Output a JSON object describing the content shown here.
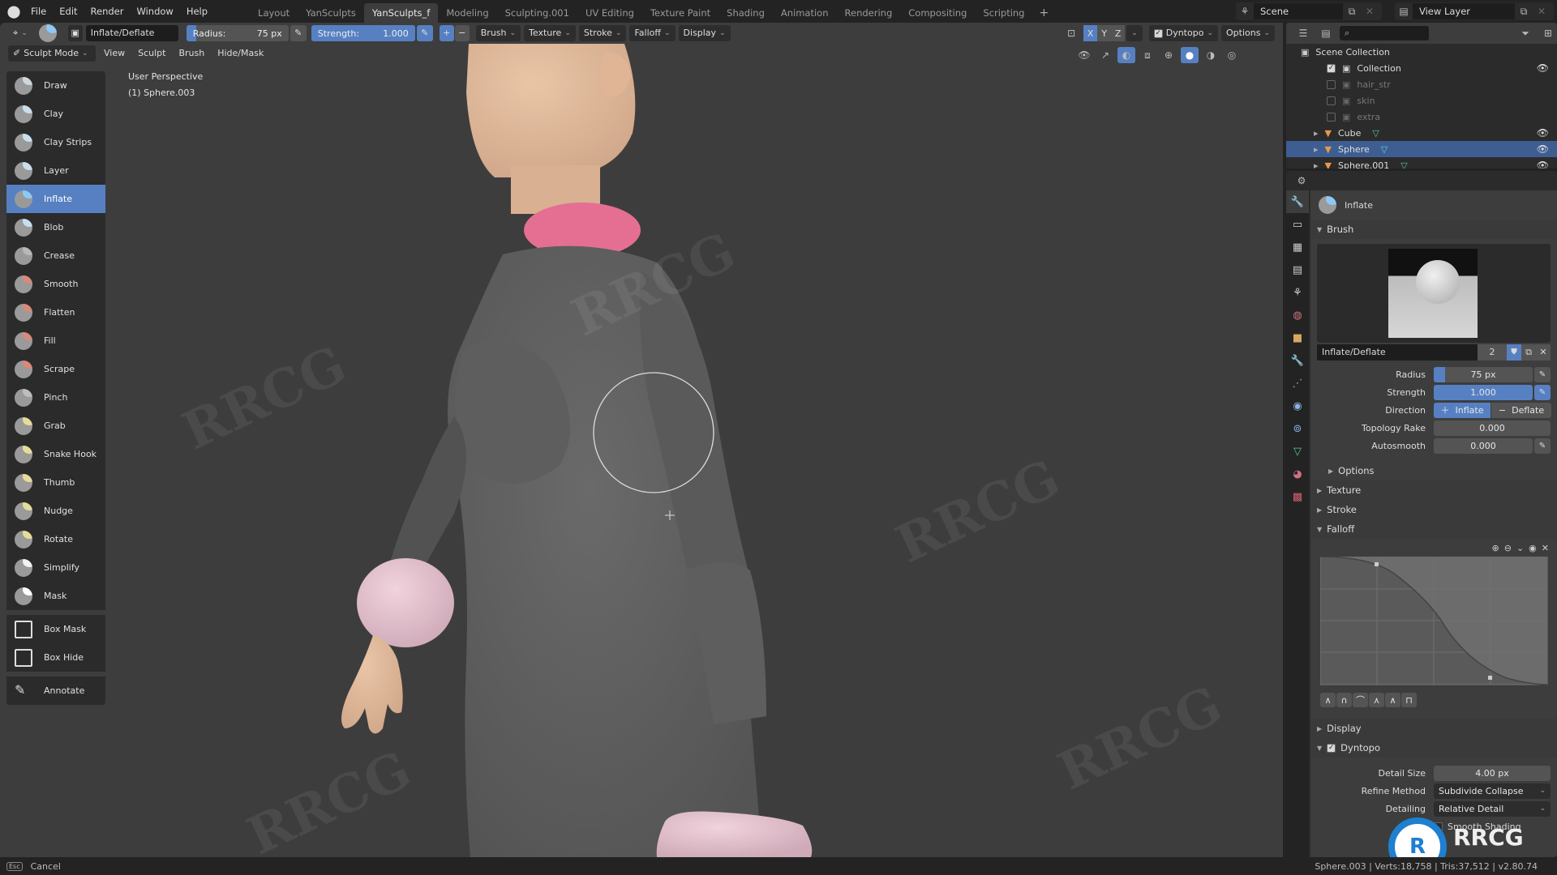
{
  "menu": {
    "items": [
      "File",
      "Edit",
      "Render",
      "Window",
      "Help"
    ]
  },
  "workspaces": {
    "tabs": [
      "Layout",
      "YanSculpts",
      "YanSculpts_f",
      "Modeling",
      "Sculpting.001",
      "UV Editing",
      "Texture Paint",
      "Shading",
      "Animation",
      "Rendering",
      "Compositing",
      "Scripting"
    ],
    "active_index": 2,
    "add_label": "+"
  },
  "scene": {
    "name": "Scene"
  },
  "view_layer": {
    "name": "View Layer"
  },
  "tool_header": {
    "brush_name": "Inflate/Deflate",
    "radius_label": "Radius:",
    "radius_value": "75 px",
    "strength_label": "Strength:",
    "strength_value": "1.000",
    "plus": "+",
    "minus": "−",
    "menus": [
      "Brush",
      "Texture",
      "Stroke",
      "Falloff",
      "Display"
    ],
    "symmetry": [
      "X",
      "Y",
      "Z"
    ],
    "dyntopo_label": "Dyntopo",
    "options_label": "Options"
  },
  "mode_header": {
    "mode": "Sculpt Mode",
    "menus": [
      "View",
      "Sculpt",
      "Brush",
      "Hide/Mask"
    ]
  },
  "viewport": {
    "perspective": "User Perspective",
    "object": "(1) Sphere.003"
  },
  "tools": [
    {
      "label": "Draw",
      "cap": "#cfd6dc"
    },
    {
      "label": "Clay",
      "cap": "#c9dfee"
    },
    {
      "label": "Clay Strips",
      "cap": "#c9dfee"
    },
    {
      "label": "Layer",
      "cap": "#c9dfee"
    },
    {
      "label": "Inflate",
      "cap": "#8fc8f5",
      "active": true
    },
    {
      "label": "Blob",
      "cap": "#c7def0"
    },
    {
      "label": "Crease",
      "cap": "#b8b8b8"
    },
    {
      "label": "Smooth",
      "cap": "#d9897a"
    },
    {
      "label": "Flatten",
      "cap": "#d9897a"
    },
    {
      "label": "Fill",
      "cap": "#d9897a"
    },
    {
      "label": "Scrape",
      "cap": "#d9897a"
    },
    {
      "label": "Pinch",
      "cap": "#bdbdbd"
    },
    {
      "label": "Grab",
      "cap": "#e6dc9a"
    },
    {
      "label": "Snake Hook",
      "cap": "#e6dc9a"
    },
    {
      "label": "Thumb",
      "cap": "#e6dc9a"
    },
    {
      "label": "Nudge",
      "cap": "#e6dc9a"
    },
    {
      "label": "Rotate",
      "cap": "#e6dc9a"
    },
    {
      "label": "Simplify",
      "cap": "#f2f2f2"
    },
    {
      "label": "Mask",
      "cap": "#ffffff"
    }
  ],
  "tools_group2": [
    {
      "label": "Box Mask"
    },
    {
      "label": "Box Hide"
    }
  ],
  "tools_group3": [
    {
      "label": "Annotate"
    }
  ],
  "outliner": {
    "root": "Scene Collection",
    "rows": [
      {
        "label": "Collection",
        "checked": true,
        "visible": true,
        "dim": false,
        "type": "collection"
      },
      {
        "label": "hair_str",
        "checked": false,
        "visible": false,
        "dim": true,
        "type": "collection"
      },
      {
        "label": "skin",
        "checked": false,
        "visible": false,
        "dim": true,
        "type": "collection"
      },
      {
        "label": "extra",
        "checked": false,
        "visible": false,
        "dim": true,
        "type": "collection"
      },
      {
        "label": "Cube",
        "visible": true,
        "type": "object",
        "selected": false
      },
      {
        "label": "Sphere",
        "visible": true,
        "type": "object",
        "selected": true
      },
      {
        "label": "Sphere.001",
        "visible": true,
        "type": "object",
        "selected": false
      }
    ]
  },
  "properties": {
    "tool_name": "Inflate",
    "brush_panel": "Brush",
    "brush_datablock": "Inflate/Deflate",
    "users": "2",
    "radius_label": "Radius",
    "radius_value": "75 px",
    "strength_label": "Strength",
    "strength_value": "1.000",
    "strength_fraction": 1.0,
    "direction_label": "Direction",
    "direction_inflate": "Inflate",
    "direction_deflate": "Deflate",
    "topology_rake_label": "Topology Rake",
    "topology_rake_value": "0.000",
    "autosmooth_label": "Autosmooth",
    "autosmooth_value": "0.000",
    "subpanels": [
      "Options",
      "Texture",
      "Stroke",
      "Falloff"
    ],
    "display_panel": "Display",
    "dyntopo_panel": "Dyntopo",
    "detail_size_label": "Detail Size",
    "detail_size_value": "4.00 px",
    "refine_method_label": "Refine Method",
    "refine_method_value": "Subdivide Collapse",
    "detailing_label": "Detailing",
    "detailing_value": "Relative Detail",
    "smooth_shading_label": "Smooth Shading"
  },
  "statusbar": {
    "left": "Cancel",
    "right": "Sphere.003 | Verts:18,758 | Tris:37,512 | v2.80.74"
  },
  "colors": {
    "accent": "#5680c2",
    "selected_row": "#3e5e92",
    "viewport_bg": "#3d3d3d",
    "panel_bg": "#2b2b2b"
  }
}
